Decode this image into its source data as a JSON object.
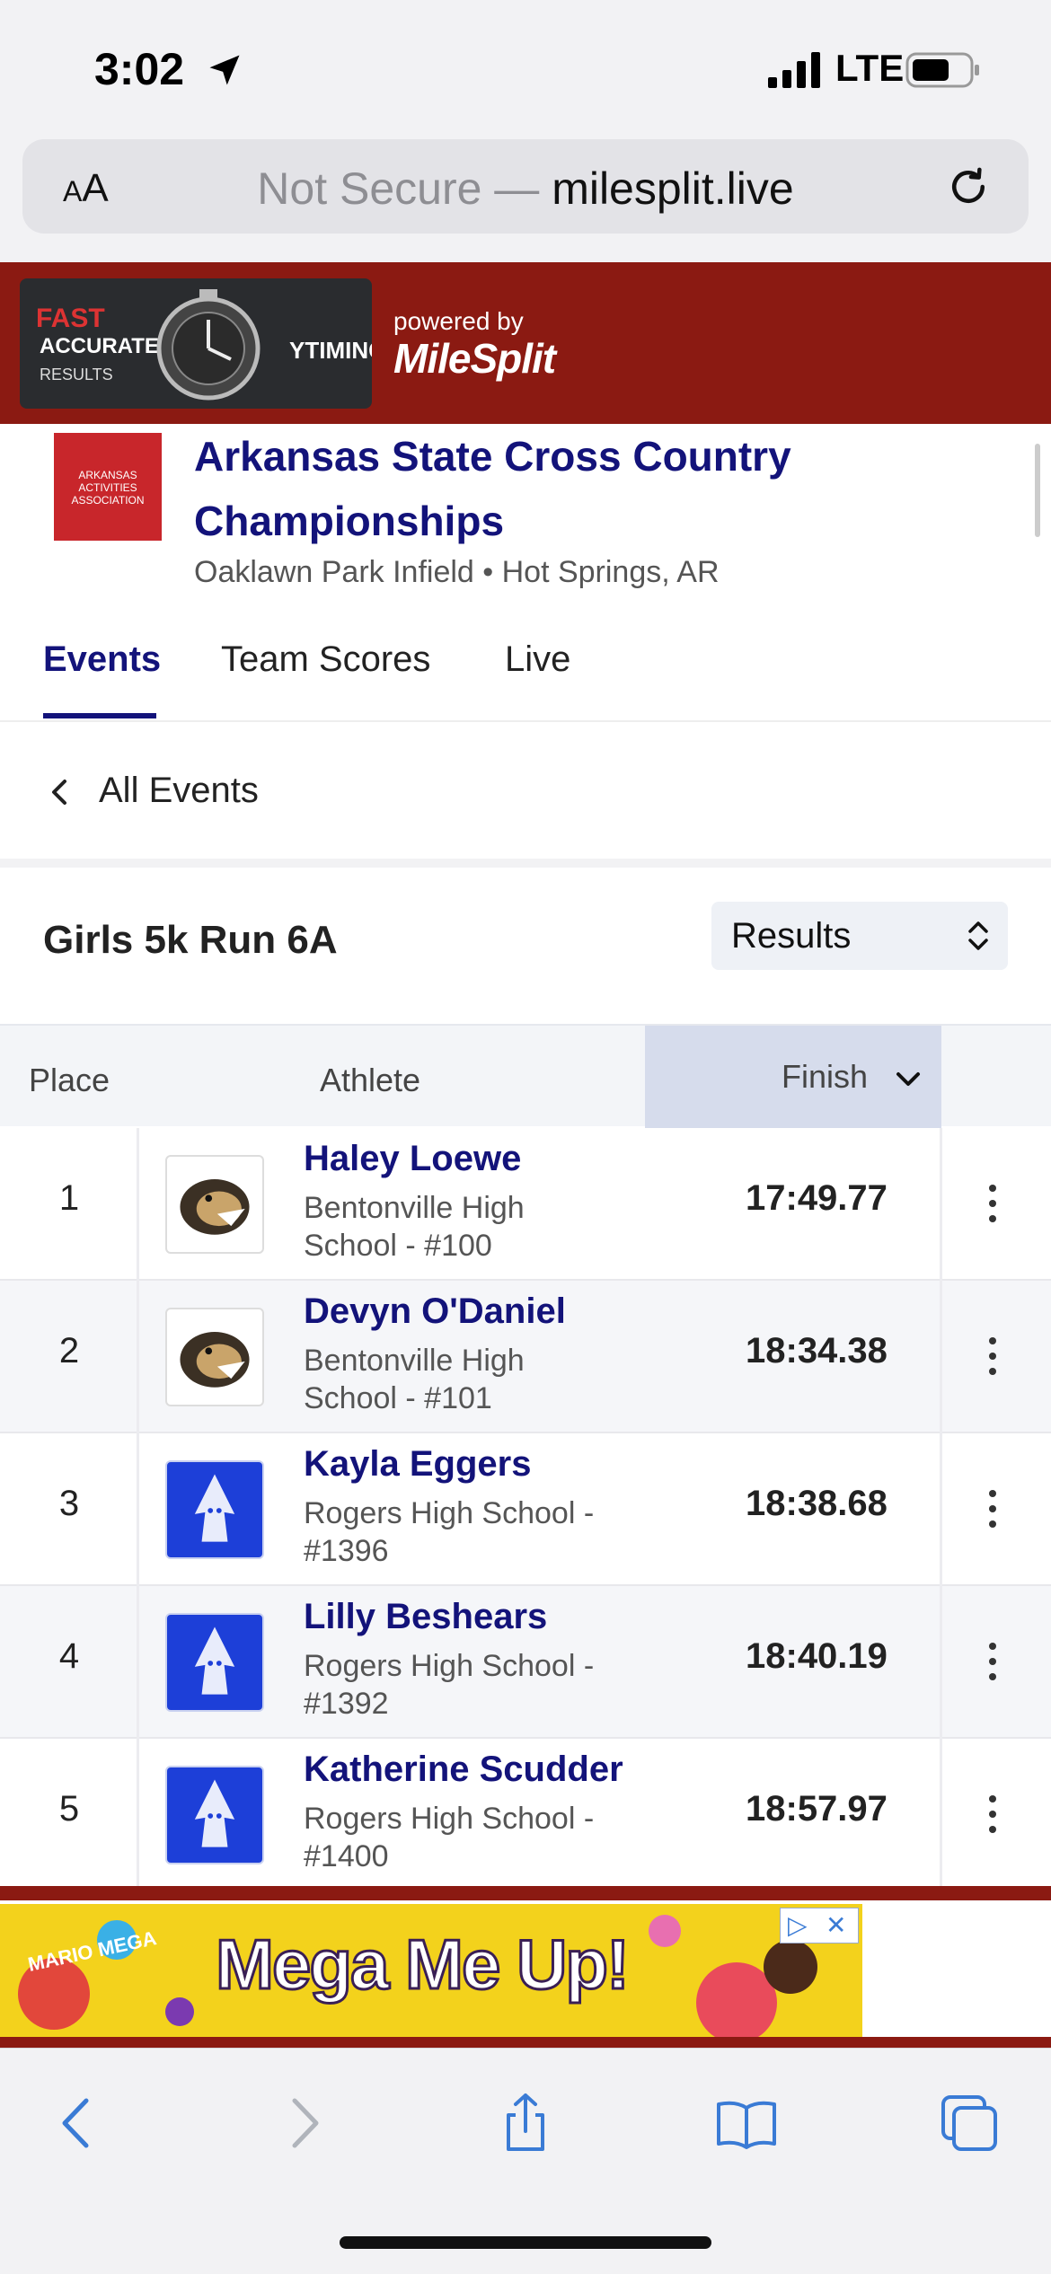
{
  "status": {
    "time": "3:02",
    "network": "LTE"
  },
  "browser": {
    "aa_label_small": "A",
    "aa_label_big": "A",
    "url_prefix": "Not Secure — ",
    "url_domain": "milesplit.live"
  },
  "header": {
    "banner_fast": "FAST",
    "banner_accurate": "ACCURATE",
    "banner_results": "RESULTS",
    "banner_ytiming": "YTIMING",
    "powered_by": "powered by",
    "brand": "MileSplit"
  },
  "meet": {
    "org_logo_text": "ARKANSAS ACTIVITIES ASSOCIATION",
    "title": "Arkansas State Cross Country Championships",
    "location": "Oaklawn Park Infield • Hot Springs, AR"
  },
  "tabs": [
    {
      "label": "Events",
      "active": true
    },
    {
      "label": "Team Scores",
      "active": false
    },
    {
      "label": "Live",
      "active": false
    }
  ],
  "back": {
    "label": "All Events"
  },
  "event": {
    "name": "Girls 5k Run 6A",
    "view_select": "Results"
  },
  "table": {
    "headers": {
      "place": "Place",
      "athlete": "Athlete",
      "finish": "Finish"
    },
    "rows": [
      {
        "place": "1",
        "name": "Haley Loewe",
        "school_line1": "Bentonville High",
        "school_line2": "School - #100",
        "finish": "17:49.77",
        "logo": "tiger-logo"
      },
      {
        "place": "2",
        "name": "Devyn O'Daniel",
        "school_line1": "Bentonville High",
        "school_line2": "School - #101",
        "finish": "18:34.38",
        "logo": "tiger-logo"
      },
      {
        "place": "3",
        "name": "Kayla Eggers",
        "school_line1": "Rogers High School -",
        "school_line2": "#1396",
        "finish": "18:38.68",
        "logo": "wizard-logo"
      },
      {
        "place": "4",
        "name": "Lilly Beshears",
        "school_line1": "Rogers High School -",
        "school_line2": "#1392",
        "finish": "18:40.19",
        "logo": "wizard-logo"
      },
      {
        "place": "5",
        "name": "Katherine Scudder",
        "school_line1": "Rogers High School -",
        "school_line2": "#1400",
        "finish": "18:57.97",
        "logo": "wizard-logo"
      }
    ]
  },
  "ad": {
    "headline": "Mega Me Up!",
    "mini": "MARIO MEGA"
  },
  "colors": {
    "brand_red": "#8b1a12",
    "link_navy": "#13137a",
    "ios_blue": "#3a7bd5"
  }
}
